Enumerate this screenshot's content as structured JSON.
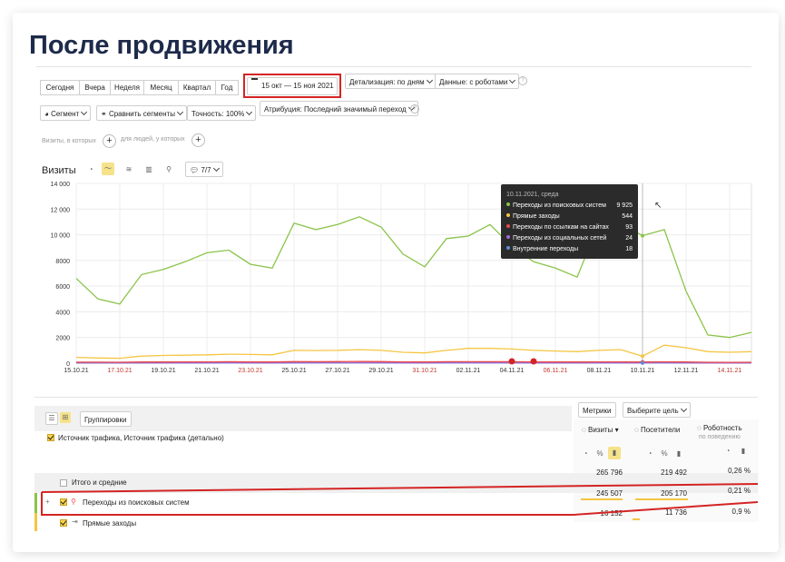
{
  "heading": "После продвижения",
  "period_tabs": [
    "Сегодня",
    "Вчера",
    "Неделя",
    "Месяц",
    "Квартал",
    "Год"
  ],
  "date_range": "15 окт — 15 ноя 2021",
  "detail_select": "Детализация: по дням",
  "data_select": "Данные: с роботами",
  "segment_btn": "Сегмент",
  "compare_btn": "Сравнить сегменты",
  "accuracy_select": "Точность: 100%",
  "attribution_select": "Атрибуция: Последний значимый переход",
  "filter_visits": "Визиты, в которых",
  "filter_people": "для людей, у которых",
  "chart_section_title": "Визиты",
  "series_count_btn": "7/7",
  "tooltip": {
    "date": "10.11.2021, среда",
    "rows": [
      {
        "label": "Переходы из поисковых систем",
        "value": "9 925",
        "color": "#8bc34a"
      },
      {
        "label": "Прямые заходы",
        "value": "544",
        "color": "#f5c542"
      },
      {
        "label": "Переходы по ссылкам на сайтах",
        "value": "93",
        "color": "#e84a4a"
      },
      {
        "label": "Переходы из социальных сетей",
        "value": "24",
        "color": "#9b6bd6"
      },
      {
        "label": "Внутренние переходы",
        "value": "18",
        "color": "#5b8fd6"
      }
    ]
  },
  "chart_data": {
    "type": "line",
    "x": [
      "15.10.21",
      "16.10.21",
      "17.10.21",
      "18.10.21",
      "19.10.21",
      "20.10.21",
      "21.10.21",
      "22.10.21",
      "23.10.21",
      "24.10.21",
      "25.10.21",
      "26.10.21",
      "27.10.21",
      "28.10.21",
      "29.10.21",
      "30.10.21",
      "31.10.21",
      "01.11.21",
      "02.11.21",
      "03.11.21",
      "04.11.21",
      "05.11.21",
      "06.11.21",
      "07.11.21",
      "08.11.21",
      "09.11.21",
      "10.11.21",
      "11.11.21",
      "12.11.21",
      "13.11.21",
      "14.11.21",
      "15.11.21"
    ],
    "x_ticks": [
      {
        "label": "15.10.21",
        "i": 0,
        "weekend": false
      },
      {
        "label": "17.10.21",
        "i": 2,
        "weekend": true
      },
      {
        "label": "19.10.21",
        "i": 4,
        "weekend": false
      },
      {
        "label": "21.10.21",
        "i": 6,
        "weekend": false
      },
      {
        "label": "23.10.21",
        "i": 8,
        "weekend": true
      },
      {
        "label": "25.10.21",
        "i": 10,
        "weekend": false
      },
      {
        "label": "27.10.21",
        "i": 12,
        "weekend": false
      },
      {
        "label": "29.10.21",
        "i": 14,
        "weekend": false
      },
      {
        "label": "31.10.21",
        "i": 16,
        "weekend": true
      },
      {
        "label": "02.11.21",
        "i": 18,
        "weekend": false
      },
      {
        "label": "04.11.21",
        "i": 20,
        "weekend": false
      },
      {
        "label": "06.11.21",
        "i": 22,
        "weekend": true
      },
      {
        "label": "08.11.21",
        "i": 24,
        "weekend": false
      },
      {
        "label": "10.11.21",
        "i": 26,
        "weekend": false
      },
      {
        "label": "12.11.21",
        "i": 28,
        "weekend": false
      },
      {
        "label": "14.11.21",
        "i": 30,
        "weekend": true
      }
    ],
    "y_ticks": [
      "0",
      "2000",
      "4000",
      "6000",
      "8000",
      "10 000",
      "12 000",
      "14 000"
    ],
    "ylim": [
      0,
      14000
    ],
    "series": [
      {
        "color": "#8bc34a",
        "values": [
          6600,
          5000,
          4600,
          6900,
          7300,
          7900,
          8600,
          8800,
          7700,
          7400,
          10900,
          10400,
          10800,
          11400,
          10600,
          8500,
          7500,
          9700,
          9900,
          10800,
          9100,
          7900,
          7400,
          6700,
          10900,
          10900,
          9925,
          10400,
          5600,
          2200,
          2000,
          2400
        ]
      },
      {
        "color": "#f5c542",
        "values": [
          450,
          400,
          380,
          550,
          600,
          620,
          650,
          700,
          680,
          650,
          1000,
          980,
          1000,
          1050,
          1000,
          850,
          800,
          1000,
          1150,
          1150,
          1100,
          1000,
          950,
          900,
          1000,
          1050,
          544,
          1400,
          1200,
          900,
          850,
          900
        ]
      },
      {
        "color": "#e84a4a",
        "values": [
          80,
          75,
          70,
          90,
          95,
          100,
          100,
          110,
          100,
          95,
          120,
          115,
          120,
          125,
          118,
          100,
          95,
          110,
          115,
          115,
          110,
          100,
          95,
          90,
          100,
          100,
          93,
          105,
          90,
          70,
          65,
          70
        ]
      },
      {
        "color": "#9b6bd6",
        "values": [
          20,
          18,
          18,
          22,
          22,
          24,
          24,
          25,
          23,
          22,
          28,
          27,
          28,
          29,
          27,
          24,
          22,
          25,
          27,
          27,
          25,
          24,
          22,
          21,
          24,
          24,
          24,
          25,
          20,
          15,
          14,
          16
        ]
      },
      {
        "color": "#5b8fd6",
        "values": [
          15,
          14,
          14,
          16,
          16,
          17,
          17,
          18,
          17,
          16,
          20,
          19,
          20,
          21,
          20,
          18,
          17,
          19,
          20,
          20,
          19,
          18,
          17,
          16,
          18,
          18,
          18,
          19,
          15,
          12,
          11,
          12
        ]
      }
    ]
  },
  "table": {
    "metrics_btn": "Метрики",
    "goal_btn": "Выберите цель",
    "groupings_btn": "Группировки",
    "dimension_header": "Источник трафика, Источник трафика (детально)",
    "col_visits": "Визиты",
    "col_visitors": "Посетители",
    "col_robotness": "Роботность",
    "col_robotness_sub": "по поведению",
    "pct_icon": "%",
    "totals_label": "Итого и средние",
    "totals": [
      "265 796",
      "219 492",
      "0,26 %"
    ],
    "rows": [
      {
        "label": "Переходы из поисковых систем",
        "values": [
          "245 507",
          "205 170",
          "0,21 %"
        ]
      },
      {
        "label": "Прямые заходы",
        "values": [
          "16 152",
          "11 736",
          "0,9 %"
        ]
      }
    ]
  },
  "accent": "#d42424",
  "brand_dark": "#1d2a4a"
}
